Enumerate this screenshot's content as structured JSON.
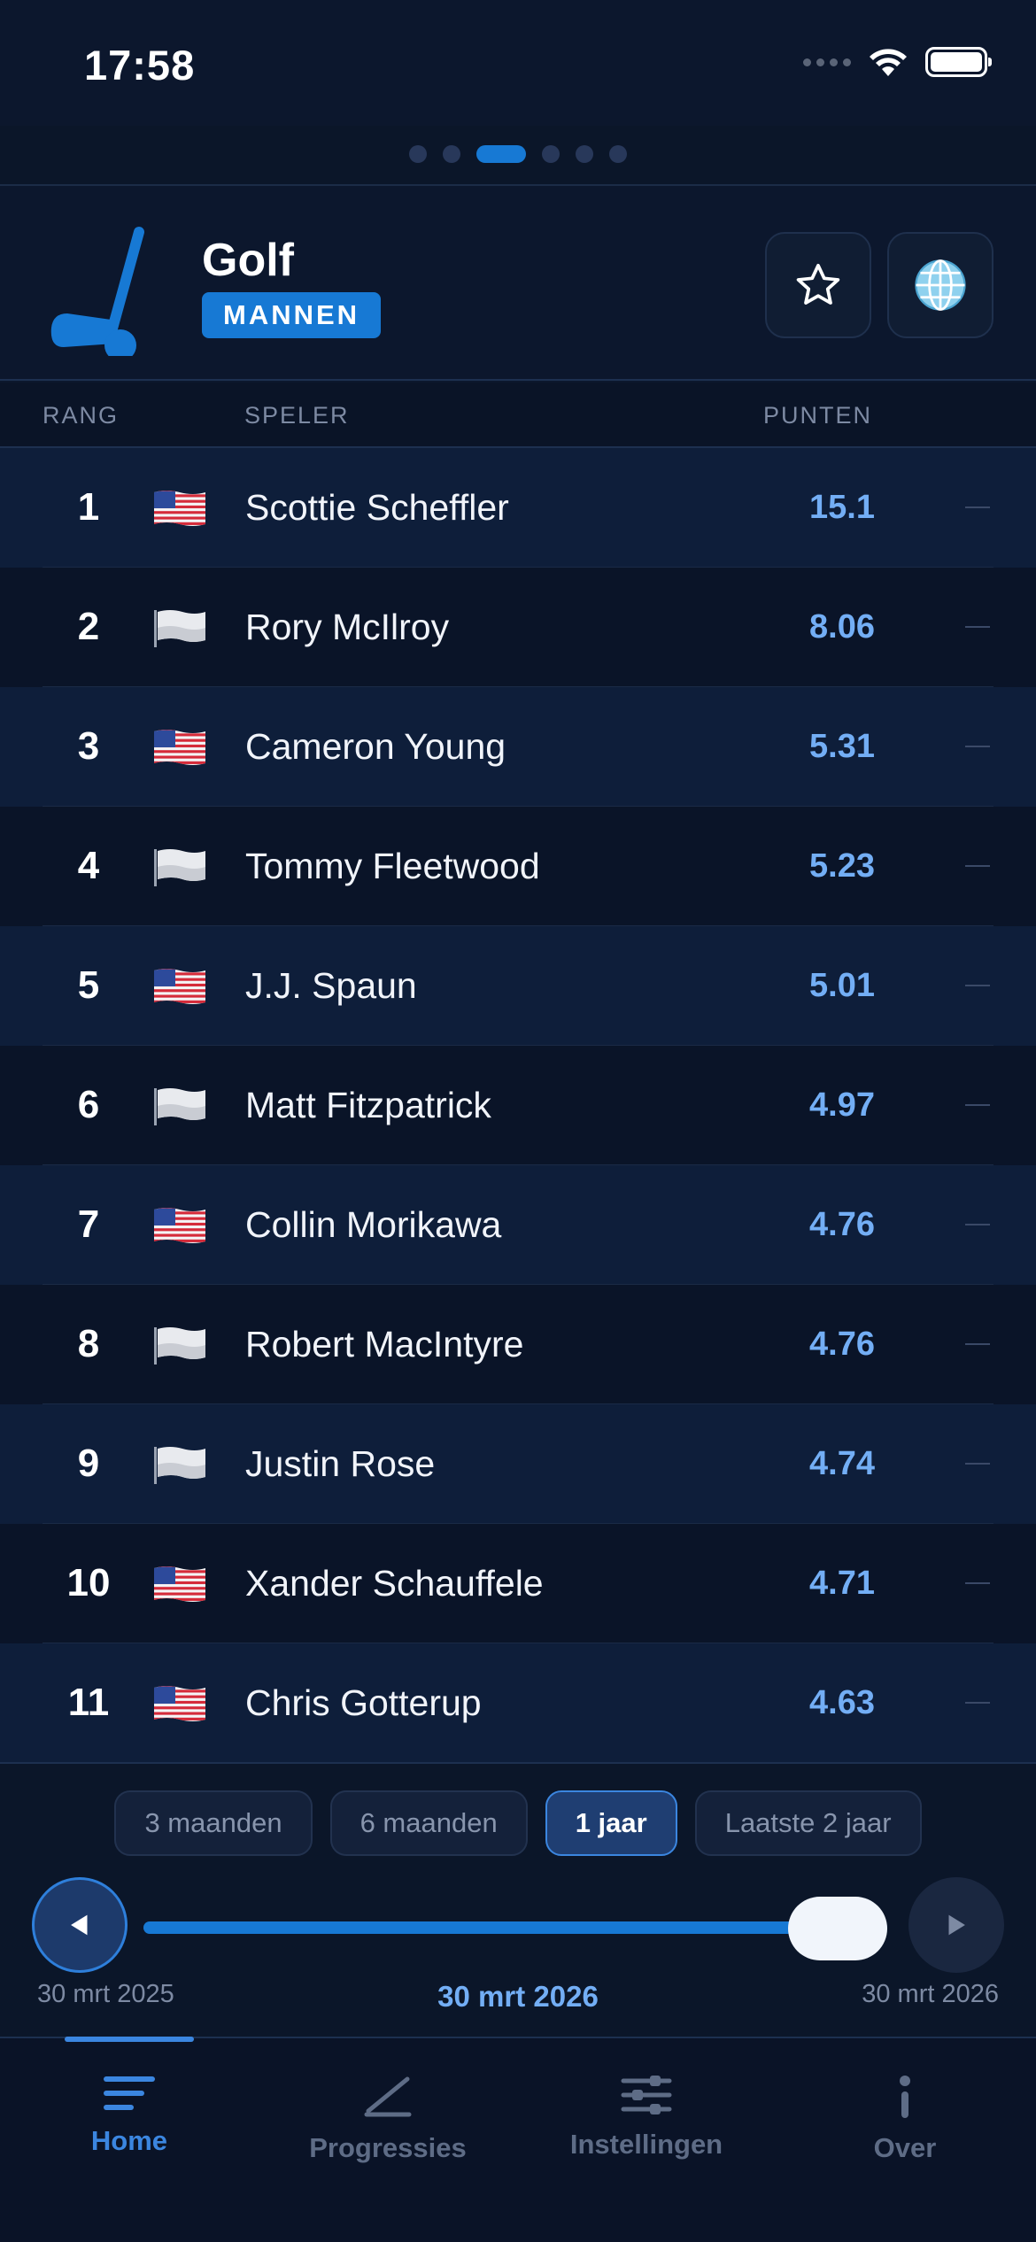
{
  "status_bar": {
    "time": "17:58"
  },
  "header": {
    "title": "Golf",
    "badge": "MANNEN",
    "sport_icon": "golf-club-icon",
    "favorite_icon": "star-icon",
    "globe_icon": "globe-icon"
  },
  "columns": {
    "rank": "RANG",
    "player": "SPELER",
    "points": "PUNTEN"
  },
  "rows": [
    {
      "rank": "1",
      "flag": "us-flag-icon",
      "player": "Scottie Scheffler",
      "points": "15.1",
      "trend": "—"
    },
    {
      "rank": "2",
      "flag": "white-flag-icon",
      "player": "Rory McIlroy",
      "points": "8.06",
      "trend": "—"
    },
    {
      "rank": "3",
      "flag": "us-flag-icon",
      "player": "Cameron Young",
      "points": "5.31",
      "trend": "—"
    },
    {
      "rank": "4",
      "flag": "white-flag-icon",
      "player": "Tommy Fleetwood",
      "points": "5.23",
      "trend": "—"
    },
    {
      "rank": "5",
      "flag": "us-flag-icon",
      "player": "J.J. Spaun",
      "points": "5.01",
      "trend": "—"
    },
    {
      "rank": "6",
      "flag": "white-flag-icon",
      "player": "Matt Fitzpatrick",
      "points": "4.97",
      "trend": "—"
    },
    {
      "rank": "7",
      "flag": "us-flag-icon",
      "player": "Collin Morikawa",
      "points": "4.76",
      "trend": "—"
    },
    {
      "rank": "8",
      "flag": "white-flag-icon",
      "player": "Robert MacIntyre",
      "points": "4.76",
      "trend": "—"
    },
    {
      "rank": "9",
      "flag": "white-flag-icon",
      "player": "Justin Rose",
      "points": "4.74",
      "trend": "—"
    },
    {
      "rank": "10",
      "flag": "us-flag-icon",
      "player": "Xander Schauffele",
      "points": "4.71",
      "trend": "—"
    },
    {
      "rank": "11",
      "flag": "us-flag-icon",
      "player": "Chris Gotterup",
      "points": "4.63",
      "trend": "—"
    }
  ],
  "periods": [
    {
      "label": "3 maanden",
      "active": false
    },
    {
      "label": "6 maanden",
      "active": false
    },
    {
      "label": "1 jaar",
      "active": true
    },
    {
      "label": "Laatste 2 jaar",
      "active": false
    }
  ],
  "timeline": {
    "start_date": "30 mrt 2025",
    "current_date": "30 mrt 2026",
    "end_date": "30 mrt 2026",
    "position": 1.0
  },
  "tabs": [
    {
      "label": "Home",
      "icon": "home-lines-icon",
      "active": true
    },
    {
      "label": "Progressies",
      "icon": "progress-chart-icon",
      "active": false
    },
    {
      "label": "Instellingen",
      "icon": "sliders-icon",
      "active": false
    },
    {
      "label": "Over",
      "icon": "info-icon",
      "active": false
    }
  ],
  "colors": {
    "accent": "#1779d4",
    "points": "#73aef5",
    "background": "#0c172d"
  }
}
